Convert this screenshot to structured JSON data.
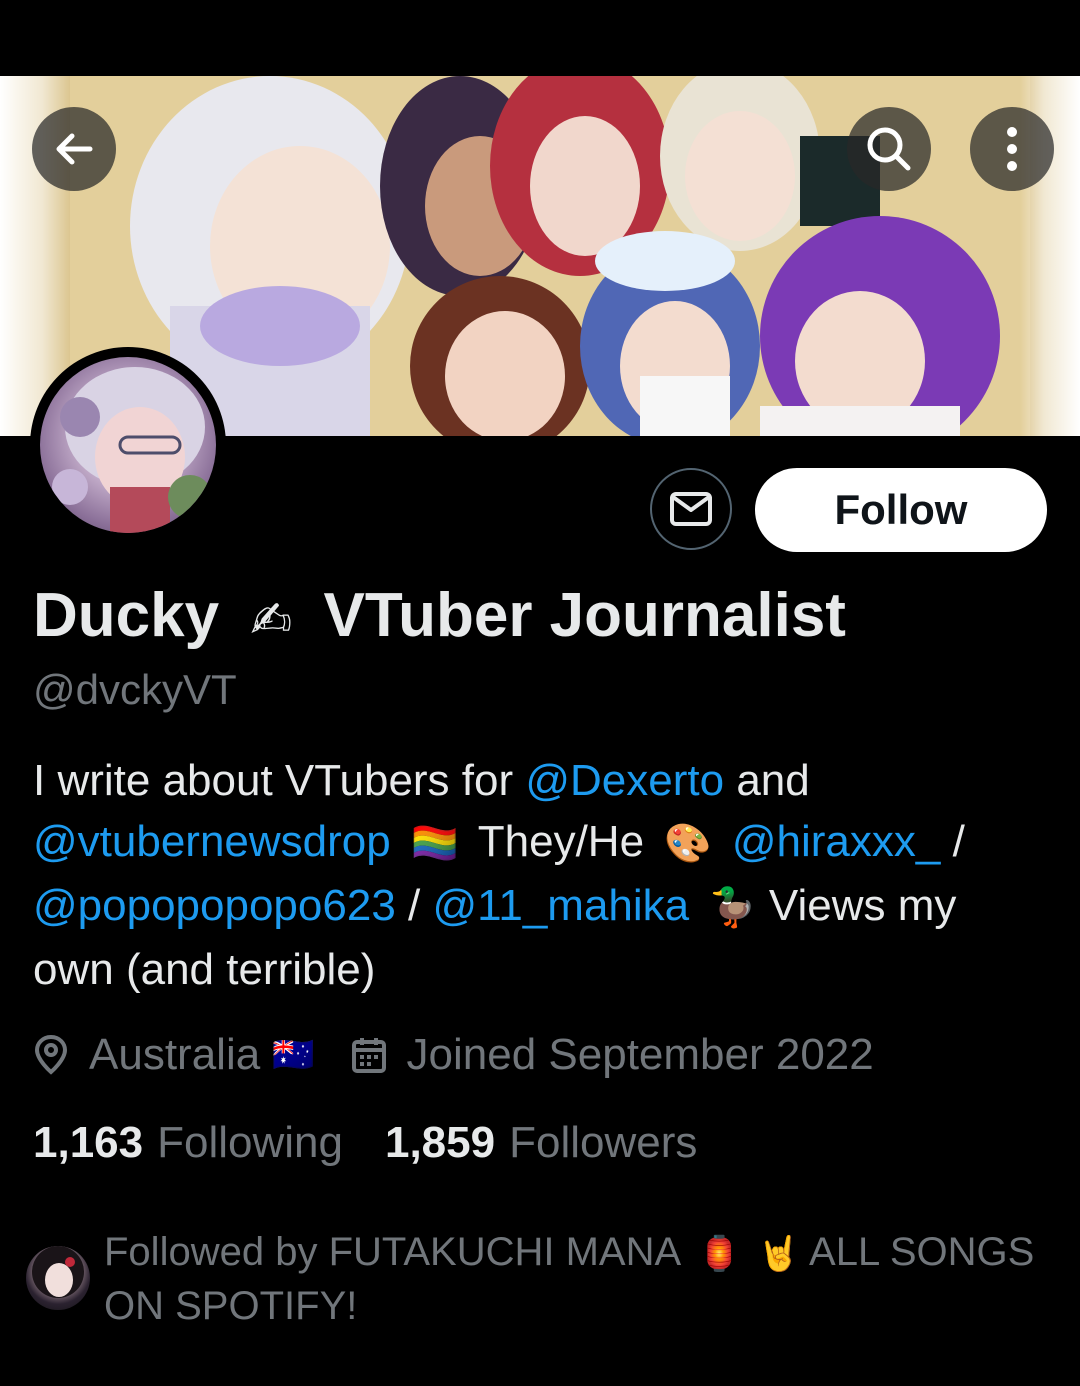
{
  "header": {
    "back_icon": "arrow-left-icon",
    "search_icon": "search-icon",
    "more_icon": "more-vertical-icon"
  },
  "profile": {
    "display_name": "Ducky",
    "name_emoji": "✍",
    "name_suffix": "VTuber Journalist",
    "handle": "@dvckyVT",
    "follow_label": "Follow",
    "message_icon": "mail-icon"
  },
  "bio": {
    "part1": "I write about VTubers for ",
    "mention_dexerto": "@Dexerto",
    "part2": " and",
    "mention_newsdrop": "@vtubernewsdrop",
    "emoji_flag": "🏳️‍🌈",
    "pronouns": "They/He",
    "emoji_palette": "🎨",
    "mention_hiraxxx": "@hiraxxx_",
    "sep1": " /",
    "mention_popopo": "@popopopopo623",
    "sep2": " / ",
    "mention_mahika": "@11_mahika",
    "emoji_duck": "🦆",
    "part3": " Views my own (and terrible)"
  },
  "meta": {
    "location": "Australia",
    "location_flag": "🇦🇺",
    "joined": "Joined September 2022"
  },
  "stats": {
    "following_count": "1,163",
    "following_label": "Following",
    "followers_count": "1,859",
    "followers_label": "Followers"
  },
  "followed_by": {
    "prefix": "Followed by ",
    "name": "FUTAKUCHI MANA",
    "emoji1": "🏮",
    "emoji2": "🤘",
    "suffix": " ALL SONGS ON SPOTIFY!"
  },
  "colors": {
    "background": "#000000",
    "link": "#1d9bf0",
    "secondary_text": "#71767b",
    "primary_text": "#e7e9ea"
  }
}
